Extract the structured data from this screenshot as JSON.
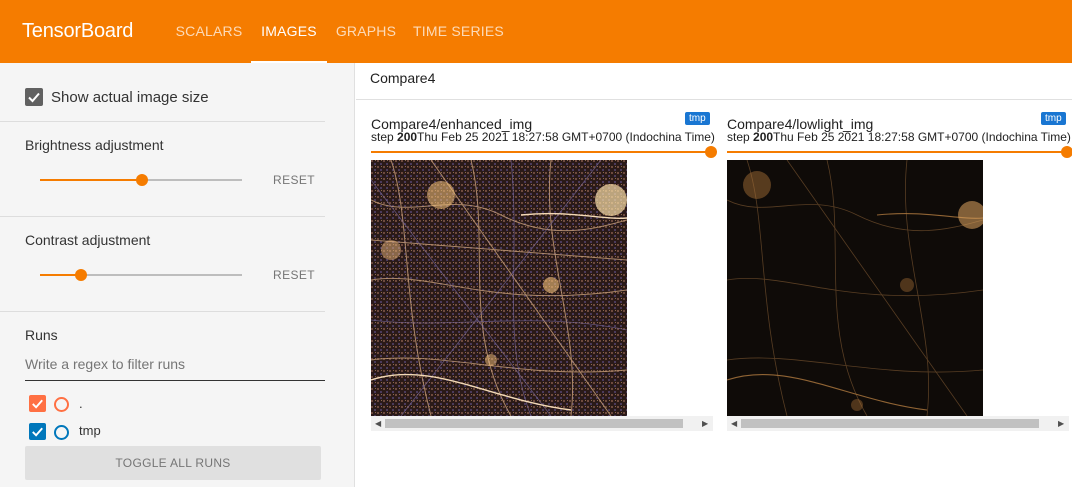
{
  "app": {
    "brand": "TensorBoard",
    "tabs": [
      {
        "label": "SCALARS",
        "active": false
      },
      {
        "label": "IMAGES",
        "active": true
      },
      {
        "label": "GRAPHS",
        "active": false
      },
      {
        "label": "TIME SERIES",
        "active": false
      }
    ],
    "accent_color": "#f57c00"
  },
  "sidebar": {
    "show_actual_size": {
      "label": "Show actual image size",
      "checked": true
    },
    "brightness": {
      "label": "Brightness adjustment",
      "value": 0.5,
      "reset_label": "RESET"
    },
    "contrast": {
      "label": "Contrast adjustment",
      "value": 0.2,
      "reset_label": "RESET"
    },
    "runs": {
      "title": "Runs",
      "filter_placeholder": "Write a regex to filter runs",
      "items": [
        {
          "label": ".",
          "checked": true,
          "color": "#ff7043"
        },
        {
          "label": "tmp",
          "checked": true,
          "color": "#0077bb"
        }
      ],
      "toggle_label": "TOGGLE ALL RUNS"
    }
  },
  "main": {
    "group_title": "Compare4",
    "cards": [
      {
        "title": "Compare4/enhanced_img",
        "run": "tmp",
        "step_prefix": "step ",
        "step": "200",
        "timestamp": "Thu Feb 25 2021 18:27:58 GMT+0700 (Indochina Time)",
        "image": "enhanced-map"
      },
      {
        "title": "Compare4/lowlight_img",
        "run": "tmp",
        "step_prefix": "step ",
        "step": "200",
        "timestamp": "Thu Feb 25 2021 18:27:58 GMT+0700 (Indochina Time)",
        "image": "lowlight-map"
      }
    ]
  }
}
